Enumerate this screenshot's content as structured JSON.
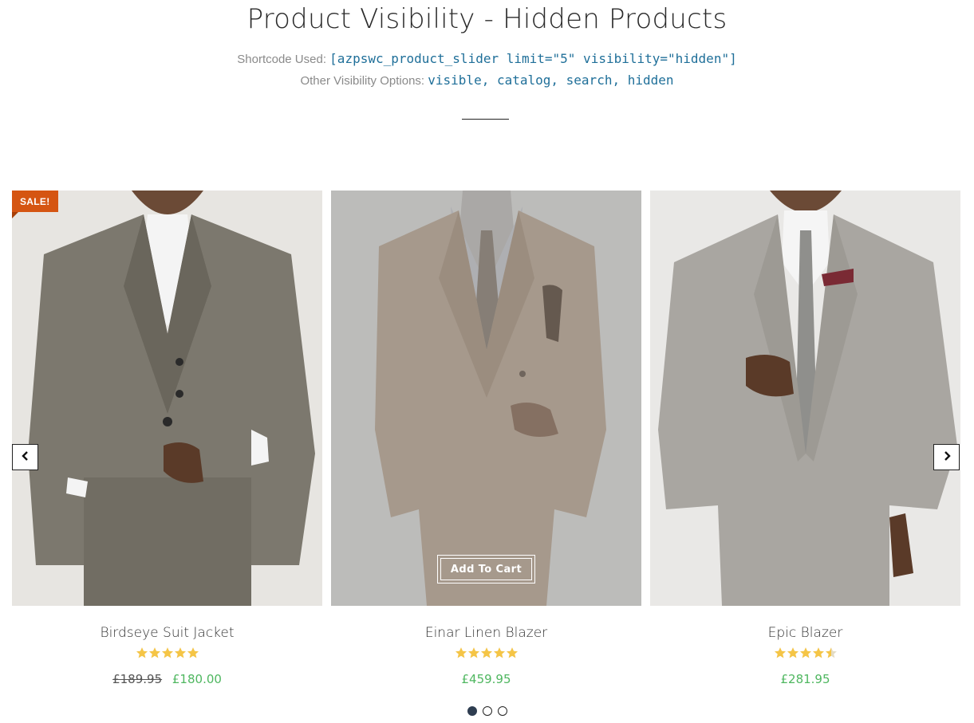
{
  "header": {
    "title": "Product Visibility - Hidden Products",
    "shortcode_label": "Shortcode Used:",
    "shortcode_value": "[azpswc_product_slider limit=\"5\" visibility=\"hidden\"]",
    "options_label": "Other Visibility Options:",
    "options_value": "visible, catalog, search, hidden"
  },
  "slider": {
    "prev_icon": "chevron-left-icon",
    "next_icon": "chevron-right-icon",
    "products": [
      {
        "name": "Birdseye Suit Jacket",
        "badge": "SALE!",
        "rating": 5,
        "price_old": "£189.95",
        "price": "£180.00"
      },
      {
        "name": "Einar Linen Blazer",
        "rating": 5,
        "price": "£459.95",
        "button_label": "Add To Cart"
      },
      {
        "name": "Epic Blazer",
        "rating": 4.5,
        "price": "£281.95"
      }
    ],
    "pagination": {
      "pages": 3,
      "active": 1
    }
  },
  "colors": {
    "sale_badge": "#d55512",
    "price": "#4fb760",
    "star": "#f5c546",
    "code": "#1f6f99"
  }
}
